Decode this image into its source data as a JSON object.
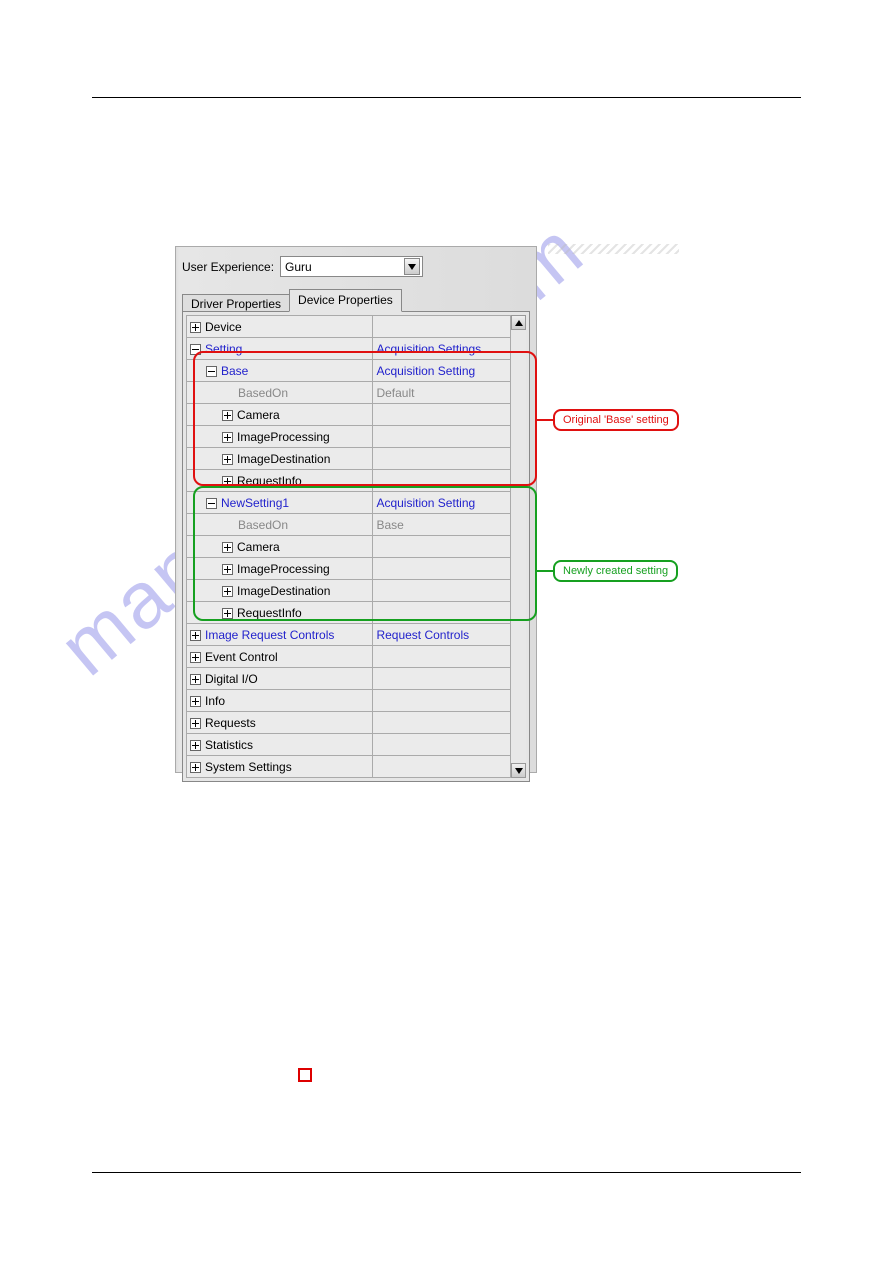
{
  "ux_label": "User Experience:",
  "ux_value": "Guru",
  "tabs": {
    "driver": "Driver Properties",
    "device": "Device Properties"
  },
  "rows": [
    {
      "indent": 0,
      "toggle": "plus",
      "label": "Device",
      "style": "",
      "value": ""
    },
    {
      "indent": 0,
      "toggle": "minus",
      "label": "Setting",
      "style": "blue",
      "value": "Acquisition Settings",
      "vstyle": "blue"
    },
    {
      "indent": 1,
      "toggle": "minus",
      "label": "Base",
      "style": "blue",
      "value": "Acquisition Setting",
      "vstyle": "blue"
    },
    {
      "indent": 2,
      "toggle": "",
      "label": "BasedOn",
      "style": "grey",
      "value": "Default",
      "vstyle": "grey"
    },
    {
      "indent": 2,
      "toggle": "plus",
      "label": "Camera",
      "style": "",
      "value": ""
    },
    {
      "indent": 2,
      "toggle": "plus",
      "label": "ImageProcessing",
      "style": "",
      "value": ""
    },
    {
      "indent": 2,
      "toggle": "plus",
      "label": "ImageDestination",
      "style": "",
      "value": ""
    },
    {
      "indent": 2,
      "toggle": "plus",
      "label": "RequestInfo",
      "style": "",
      "value": ""
    },
    {
      "indent": 1,
      "toggle": "minus",
      "label": "NewSetting1",
      "style": "blue",
      "value": "Acquisition Setting",
      "vstyle": "blue"
    },
    {
      "indent": 2,
      "toggle": "",
      "label": "BasedOn",
      "style": "grey",
      "value": "Base",
      "vstyle": "grey"
    },
    {
      "indent": 2,
      "toggle": "plus",
      "label": "Camera",
      "style": "",
      "value": ""
    },
    {
      "indent": 2,
      "toggle": "plus",
      "label": "ImageProcessing",
      "style": "",
      "value": ""
    },
    {
      "indent": 2,
      "toggle": "plus",
      "label": "ImageDestination",
      "style": "",
      "value": ""
    },
    {
      "indent": 2,
      "toggle": "plus",
      "label": "RequestInfo",
      "style": "",
      "value": ""
    },
    {
      "indent": 0,
      "toggle": "plus",
      "label": "Image Request Controls",
      "style": "blue",
      "value": "Request Controls",
      "vstyle": "blue"
    },
    {
      "indent": 0,
      "toggle": "plus",
      "label": "Event Control",
      "style": "",
      "value": ""
    },
    {
      "indent": 0,
      "toggle": "plus",
      "label": "Digital I/O",
      "style": "",
      "value": ""
    },
    {
      "indent": 0,
      "toggle": "plus",
      "label": "Info",
      "style": "",
      "value": ""
    },
    {
      "indent": 0,
      "toggle": "plus",
      "label": "Requests",
      "style": "",
      "value": ""
    },
    {
      "indent": 0,
      "toggle": "plus",
      "label": "Statistics",
      "style": "",
      "value": ""
    },
    {
      "indent": 0,
      "toggle": "plus",
      "label": "System Settings",
      "style": "",
      "value": ""
    }
  ],
  "callouts": {
    "original": "Original 'Base' setting",
    "newly": "Newly created setting"
  },
  "watermark": "manualshive.com"
}
